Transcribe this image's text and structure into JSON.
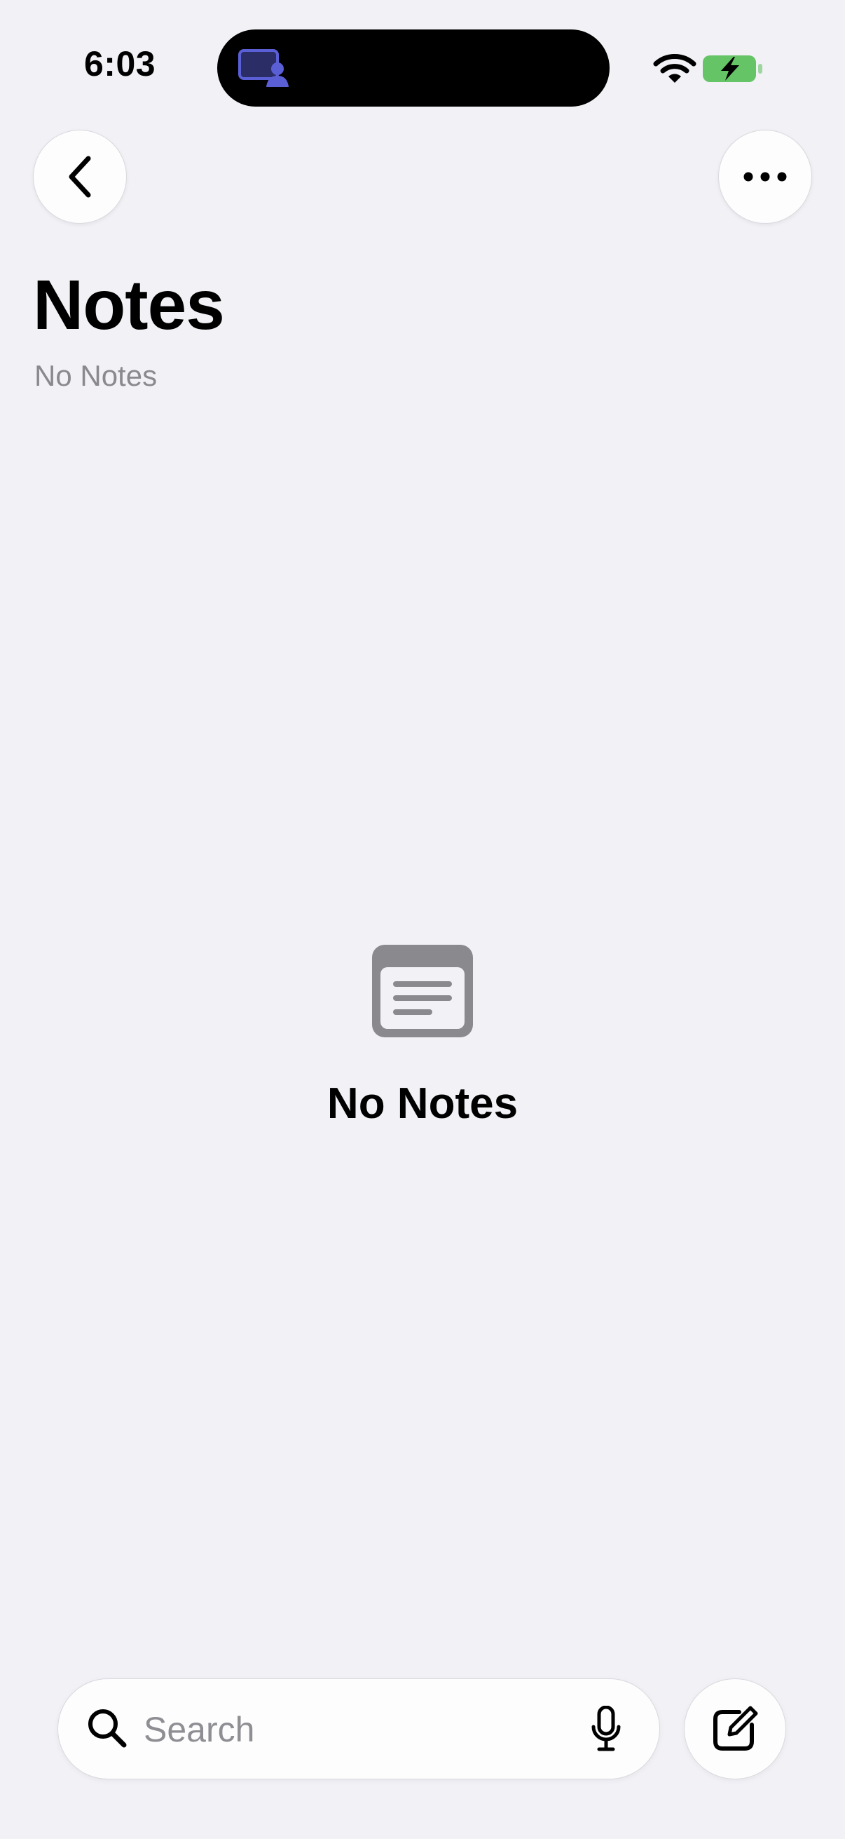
{
  "status_bar": {
    "time": "6:03",
    "island_icon": "screen-sharing-person-icon",
    "wifi_icon": "wifi-icon",
    "battery_icon": "battery-charging-icon",
    "battery_color": "#65c466"
  },
  "nav": {
    "back_icon": "chevron-left-icon",
    "more_icon": "ellipsis-icon"
  },
  "header": {
    "title": "Notes",
    "subtitle": "No Notes"
  },
  "empty_state": {
    "icon": "note-icon",
    "label": "No Notes"
  },
  "bottom_bar": {
    "search_placeholder": "Search",
    "search_value": "",
    "search_icon": "search-icon",
    "mic_icon": "microphone-icon",
    "compose_icon": "compose-icon"
  },
  "colors": {
    "background": "#f1f1f6",
    "secondary_text": "#8a8a8e",
    "placeholder": "#8e8e93",
    "empty_icon": "#8a8a8e",
    "island_accent": "#5b5fd6"
  }
}
